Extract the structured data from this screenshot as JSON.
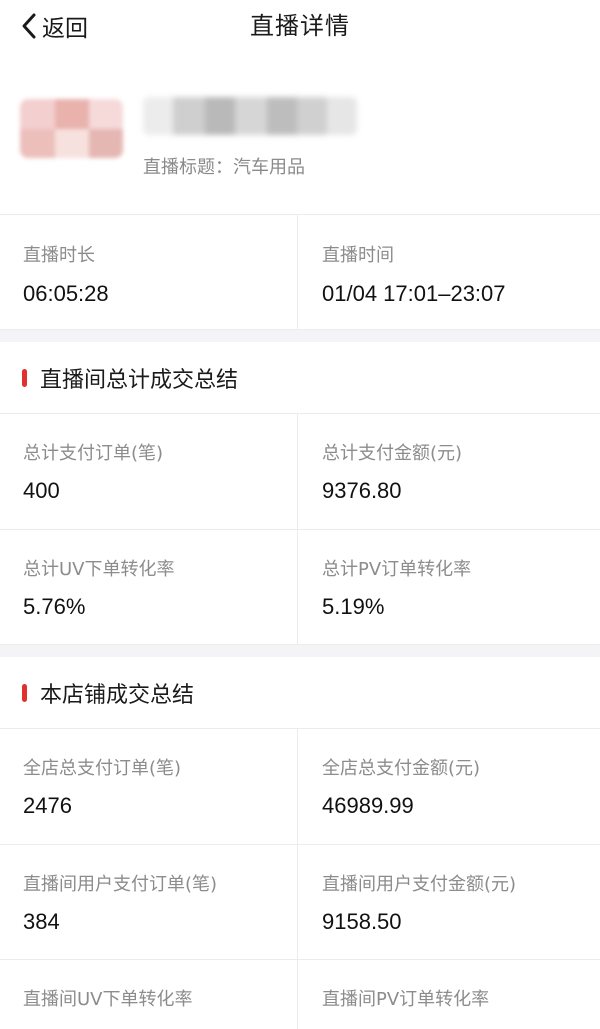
{
  "colors": {
    "accent": "#e0322d",
    "label": "#8c8c8c",
    "value": "#111111",
    "divider": "#ececec",
    "section_gap": "#f4f4f6"
  },
  "nav": {
    "back_icon": "chevron-left-icon",
    "back_label": "返回",
    "title": "直播详情"
  },
  "profile": {
    "subtitle": "直播标题：汽车用品"
  },
  "live_info": [
    {
      "label": "直播时长",
      "value": "06:05:28"
    },
    {
      "label": "直播时间",
      "value": "01/04 17:01–23:07"
    }
  ],
  "room_summary": {
    "title": "直播间总计成交总结",
    "rows": [
      [
        {
          "label": "总计支付订单(笔)",
          "value": "400"
        },
        {
          "label": "总计支付金额(元)",
          "value": "9376.80"
        }
      ],
      [
        {
          "label": "总计UV下单转化率",
          "value": "5.76%"
        },
        {
          "label": "总计PV订单转化率",
          "value": "5.19%"
        }
      ]
    ]
  },
  "store_summary": {
    "title": "本店铺成交总结",
    "rows": [
      [
        {
          "label": "全店总支付订单(笔)",
          "value": "2476"
        },
        {
          "label": "全店总支付金额(元)",
          "value": "46989.99"
        }
      ],
      [
        {
          "label": "直播间用户支付订单(笔)",
          "value": "384"
        },
        {
          "label": "直播间用户支付金额(元)",
          "value": "9158.50"
        }
      ],
      [
        {
          "label": "直播间UV下单转化率",
          "value": ""
        },
        {
          "label": "直播间PV订单转化率",
          "value": ""
        }
      ]
    ]
  }
}
